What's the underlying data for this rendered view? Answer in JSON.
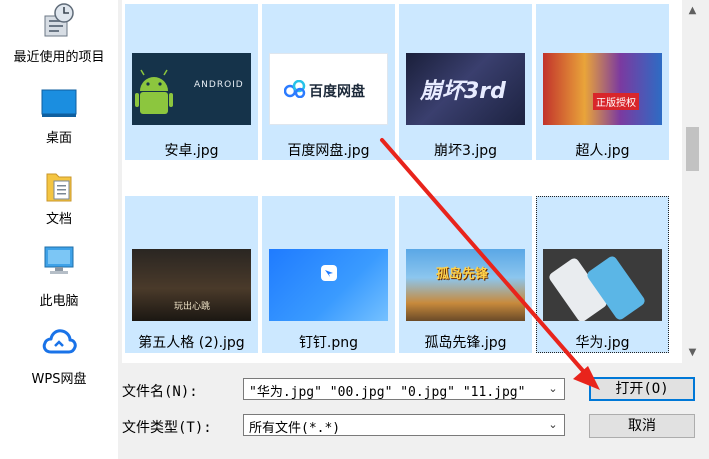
{
  "nav": {
    "items": [
      {
        "label": "最近使用的项目",
        "icon": "recent-items-icon"
      },
      {
        "label": "桌面",
        "icon": "desktop-icon"
      },
      {
        "label": "文档",
        "icon": "documents-icon"
      },
      {
        "label": "此电脑",
        "icon": "this-pc-icon"
      },
      {
        "label": "WPS网盘",
        "icon": "wps-cloud-icon"
      }
    ]
  },
  "files": [
    {
      "name": "安卓.jpg",
      "thumb_text": "ANDROID"
    },
    {
      "name": "百度网盘.jpg",
      "thumb_text": "百度网盘"
    },
    {
      "name": "崩坏3.jpg",
      "thumb_text": "崩坏3rd"
    },
    {
      "name": "超人.jpg",
      "thumb_text": "正版授权"
    },
    {
      "name": "第五人格 (2).jpg",
      "thumb_text": "玩出心跳"
    },
    {
      "name": "钉钉.png",
      "thumb_text": ""
    },
    {
      "name": "孤岛先锋.jpg",
      "thumb_text": "孤岛先锋"
    },
    {
      "name": "华为.jpg",
      "thumb_text": ""
    }
  ],
  "form": {
    "filename_label": "文件名(N):",
    "filename_value": "\"华为.jpg\" \"00.jpg\" \"0.jpg\" \"11.jpg\"",
    "filetype_label": "文件类型(T):",
    "filetype_value": "所有文件(*.*)"
  },
  "buttons": {
    "open": "打开(O)",
    "cancel": "取消"
  },
  "colors": {
    "selection": "#cce8ff",
    "primary_border": "#0078d7",
    "annotation_arrow": "#e8241c"
  }
}
